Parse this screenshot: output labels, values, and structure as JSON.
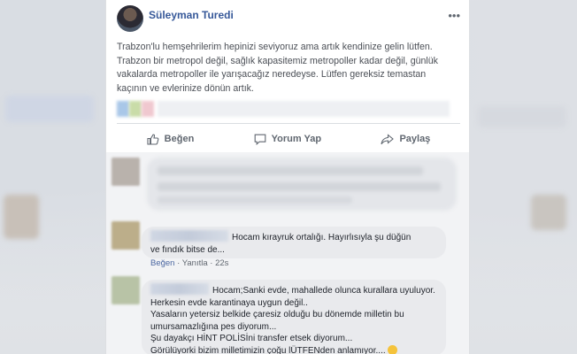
{
  "post": {
    "author": "Süleyman Turedi",
    "more_icon": "•••",
    "text_lines": [
      "Trabzon'lu hemşehrilerim hepinizi seviyoruz ama artık kendinize gelin lütfen.",
      "Trabzon bir metropol değil, sağlık kapasitemiz metropoller kadar değil, günlük",
      "vakalarda metropoller ile yarışacağız neredeyse. Lütfen gereksiz temastan",
      "kaçının ve evlerinize dönün artık."
    ]
  },
  "actions": {
    "like": "Beğen",
    "comment": "Yorum Yap",
    "share": "Paylaş"
  },
  "comments": [
    {
      "lines": [
        "Hocam kırayruk ortalığı. Hayırlısıyla şu düğün",
        "ve fındık bitse de..."
      ],
      "like": "Beğen",
      "reply": "Yanıtla",
      "time": "22s",
      "sep": "·"
    },
    {
      "lines": [
        "Hocam;Sanki evde, mahallede olunca kurallara uyuluyor.",
        "Herkesin evde karantinaya uygun değil..",
        "Yasaların yetersiz belkide çaresiz olduğu bu dönemde milletin bu",
        "umursamazlığına pes diyorum...",
        "Şu dayakçı HİNT POLİSİni transfer etsek diyorum...",
        "Görülüyorki bizim milletimizin çoğu lÜTFENden anlamıyor...."
      ]
    }
  ],
  "colors": {
    "author": "#365899",
    "action_text": "#606770",
    "bubble": "#e9eaed",
    "comment_link": "#4b67a1"
  }
}
